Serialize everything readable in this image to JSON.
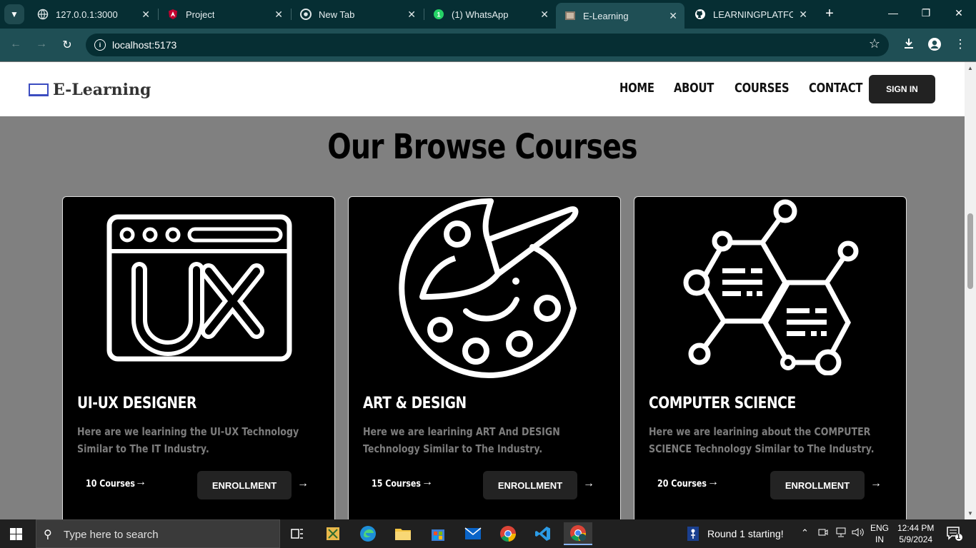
{
  "browser": {
    "tabs": [
      {
        "title": "127.0.0.1:3000"
      },
      {
        "title": "Project"
      },
      {
        "title": "New Tab"
      },
      {
        "title": "(1) WhatsApp"
      },
      {
        "title": "E-Learning"
      },
      {
        "title": "LEARNINGPLATFORM"
      }
    ],
    "url": "localhost:5173",
    "new_tab": "+"
  },
  "site": {
    "logo_text": "E-Learning",
    "nav": [
      "HOME",
      "ABOUT",
      "COURSES",
      "CONTACT"
    ],
    "signin_label": "SIGN IN",
    "section_title": "Our Browse Courses",
    "courses": [
      {
        "title": "UI-UX DESIGNER",
        "desc": "Here are we learining the UI-UX Technology Similar to The IT Industry.",
        "count": "10 Courses",
        "enroll": "ENROLLMENT",
        "icon": "ux-window-icon"
      },
      {
        "title": "ART & DESIGN",
        "desc": "Here we are learining ART And DESIGN Technology Similar to The Industry.",
        "count": "15 Courses",
        "enroll": "ENROLLMENT",
        "icon": "palette-icon"
      },
      {
        "title": "COMPUTER SCIENCE",
        "desc": "Here we are learining about the COMPUTER SCIENCE Technology Similar to The Industry.",
        "count": "20 Courses",
        "enroll": "ENROLLMENT",
        "icon": "network-hexagon-icon"
      }
    ]
  },
  "taskbar": {
    "search_placeholder": "Type here to search",
    "notification": "Round 1 starting!",
    "lang_line1": "ENG",
    "lang_line2": "IN",
    "time": "12:44 PM",
    "date": "5/9/2024",
    "notif_count": "1"
  }
}
